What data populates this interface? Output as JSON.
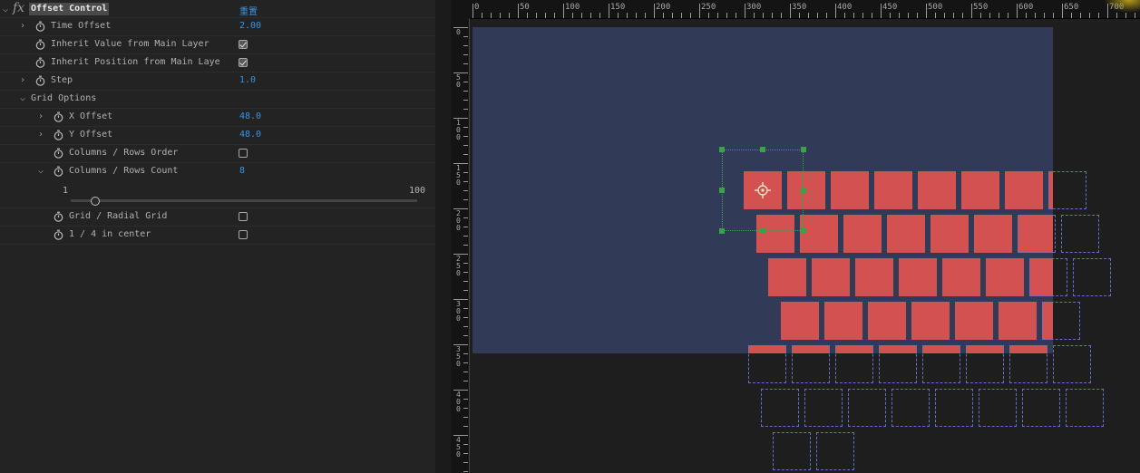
{
  "effect_controls": {
    "fx_label": "fx",
    "effect_name": "Offset Control",
    "reset_label": "重置",
    "properties": [
      {
        "label": "Time Offset",
        "value": "2.00"
      },
      {
        "label": "Inherit Value from Main Layer",
        "checked": true
      },
      {
        "label": "Inherit Position from Main Laye",
        "checked": true
      },
      {
        "label": "Step",
        "value": "1.0"
      },
      {
        "label": "Grid Options"
      },
      {
        "label": "X Offset",
        "value": "48.0"
      },
      {
        "label": "Y Offset",
        "value": "48.0"
      },
      {
        "label": "Columns / Rows Order",
        "checked": false
      },
      {
        "label": "Columns / Rows Count",
        "value": "8"
      },
      {
        "label": "Grid / Radial Grid",
        "checked": false
      },
      {
        "label": "1 / 4 in center",
        "checked": false
      }
    ],
    "slider": {
      "min_label": "1",
      "max_label": "100",
      "value": 8
    }
  },
  "viewer": {
    "ruler_top_labels": [
      "0",
      "50",
      "100",
      "150",
      "200",
      "250",
      "300",
      "350",
      "400",
      "450",
      "500",
      "550",
      "600",
      "650",
      "700"
    ],
    "ruler_left_labels": [
      "0",
      "50",
      "100",
      "150",
      "200",
      "250",
      "300",
      "350",
      "400",
      "450"
    ],
    "colors": {
      "composition_bg": "#313a56",
      "tile": "#d45151",
      "tile_outline": "#5f72cf",
      "selection": "#37a347"
    }
  }
}
